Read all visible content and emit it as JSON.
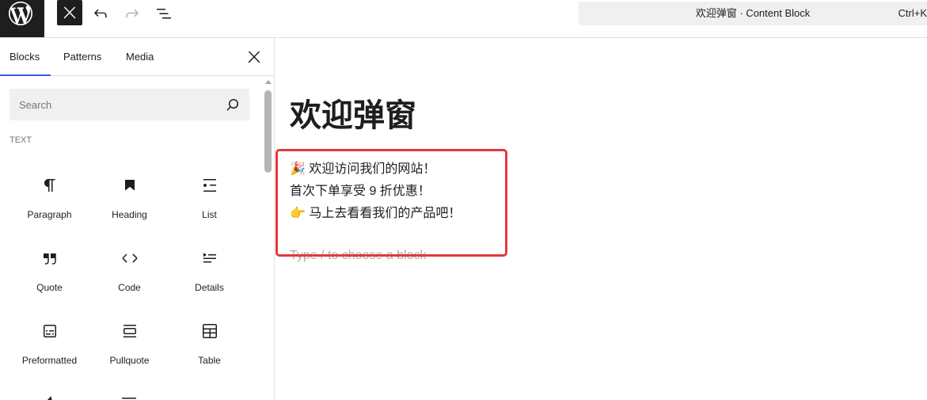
{
  "app": {
    "logo_icon": "wordpress-logo-icon"
  },
  "header": {
    "close_inserter_icon": "close-icon",
    "undo_icon": "undo-icon",
    "redo_icon": "redo-icon",
    "redo_enabled": false,
    "document_overview_icon": "list-view-icon"
  },
  "command_bar": {
    "title": "欢迎弹窗 · Content Block",
    "shortcut": "Ctrl+K"
  },
  "inserter": {
    "tabs": [
      {
        "label": "Blocks",
        "active": true
      },
      {
        "label": "Patterns",
        "active": false
      },
      {
        "label": "Media",
        "active": false
      }
    ],
    "close_icon": "close-icon",
    "search": {
      "placeholder": "Search",
      "icon": "search-icon"
    },
    "category": "TEXT",
    "blocks": [
      {
        "label": "Paragraph",
        "icon": "paragraph-icon"
      },
      {
        "label": "Heading",
        "icon": "heading-icon"
      },
      {
        "label": "List",
        "icon": "list-icon"
      },
      {
        "label": "Quote",
        "icon": "quote-icon"
      },
      {
        "label": "Code",
        "icon": "code-icon"
      },
      {
        "label": "Details",
        "icon": "details-icon"
      },
      {
        "label": "Preformatted",
        "icon": "preformatted-icon"
      },
      {
        "label": "Pullquote",
        "icon": "pullquote-icon"
      },
      {
        "label": "Table",
        "icon": "table-icon"
      }
    ]
  },
  "editor": {
    "title": "欢迎弹窗",
    "paragraph_lines": [
      "🎉 欢迎访问我们的网站！",
      "首次下单享受 9 折优惠！",
      "👉 马上去看看我们的产品吧！"
    ],
    "block_placeholder": "Type / to choose a block"
  },
  "colors": {
    "accent": "#3858e9",
    "dark": "#1e1e1e",
    "highlight": "#e5383b",
    "surface": "#f0f0f0"
  }
}
